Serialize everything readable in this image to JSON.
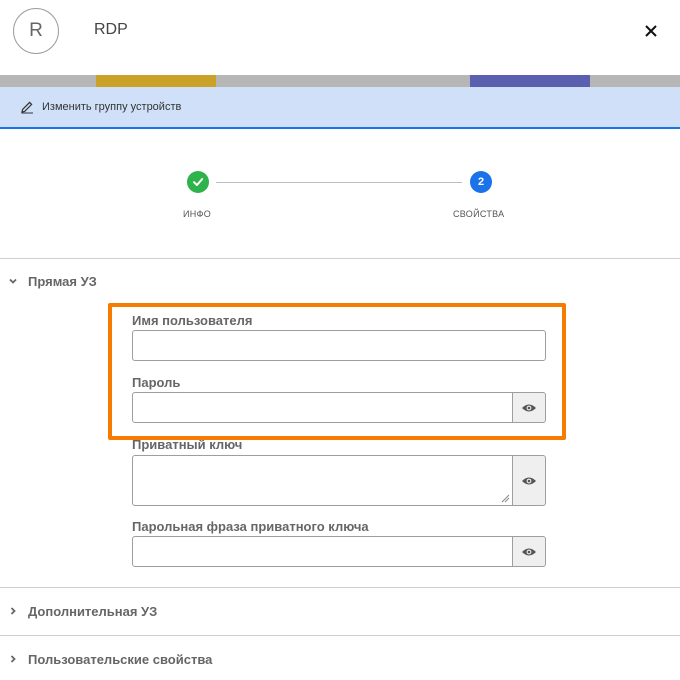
{
  "header": {
    "avatar_letter": "R",
    "title": "RDP",
    "close_icon": "close-icon"
  },
  "action_bar": {
    "icon": "pencil-icon",
    "label": "Изменить группу устройств",
    "accent_color": "#1a73e8"
  },
  "stepper": {
    "steps": [
      {
        "number": "1",
        "label": "ИНФО",
        "status": "completed",
        "color": "#2eb24c"
      },
      {
        "number": "2",
        "label": "СВОЙСТВА",
        "status": "active",
        "color": "#1a73e8"
      }
    ]
  },
  "sections": {
    "direct": {
      "label": "Прямая УЗ",
      "expanded": true
    },
    "additional": {
      "label": "Дополнительная УЗ",
      "expanded": false
    },
    "custom": {
      "label": "Пользовательские свойства",
      "expanded": false
    }
  },
  "form": {
    "username_label": "Имя пользователя",
    "username_value": "",
    "password_label": "Пароль",
    "password_value": "",
    "private_key_label": "Приватный ключ",
    "private_key_value": "",
    "passphrase_label": "Парольная фраза приватного ключа",
    "passphrase_value": ""
  },
  "highlight_color": "#f57c00"
}
